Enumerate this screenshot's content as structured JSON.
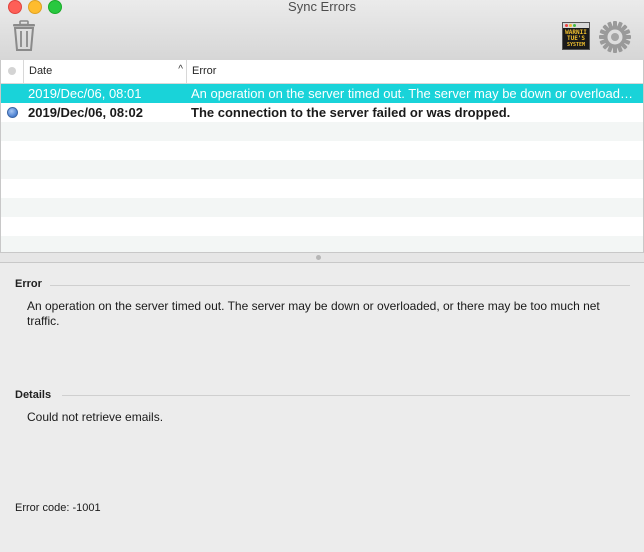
{
  "window": {
    "title": "Sync Errors"
  },
  "toolbar": {
    "warning_icon_text": [
      "WARNII",
      "TUE'S",
      "SYSTEM"
    ]
  },
  "table": {
    "columns": {
      "date": "Date",
      "error": "Error"
    },
    "rows": [
      {
        "date": "2019/Dec/06, 08:01",
        "error": "An operation on the server timed out. The server may be down or overloaded, or there may be too much net traffic.",
        "selected": true,
        "unread": false
      },
      {
        "date": "2019/Dec/06, 08:02",
        "error": "The connection to the server failed or was dropped.",
        "selected": false,
        "unread": true
      }
    ]
  },
  "detail": {
    "error_heading": "Error",
    "error_text": "An operation on the server timed out. The server may be down or overloaded, or there may be too much net traffic.",
    "details_heading": "Details",
    "details_text": "Could not retrieve emails.",
    "error_code": "Error code: -1001"
  },
  "colors": {
    "selection": "#19d3d9",
    "unread_dot": "#4a7fd1"
  }
}
